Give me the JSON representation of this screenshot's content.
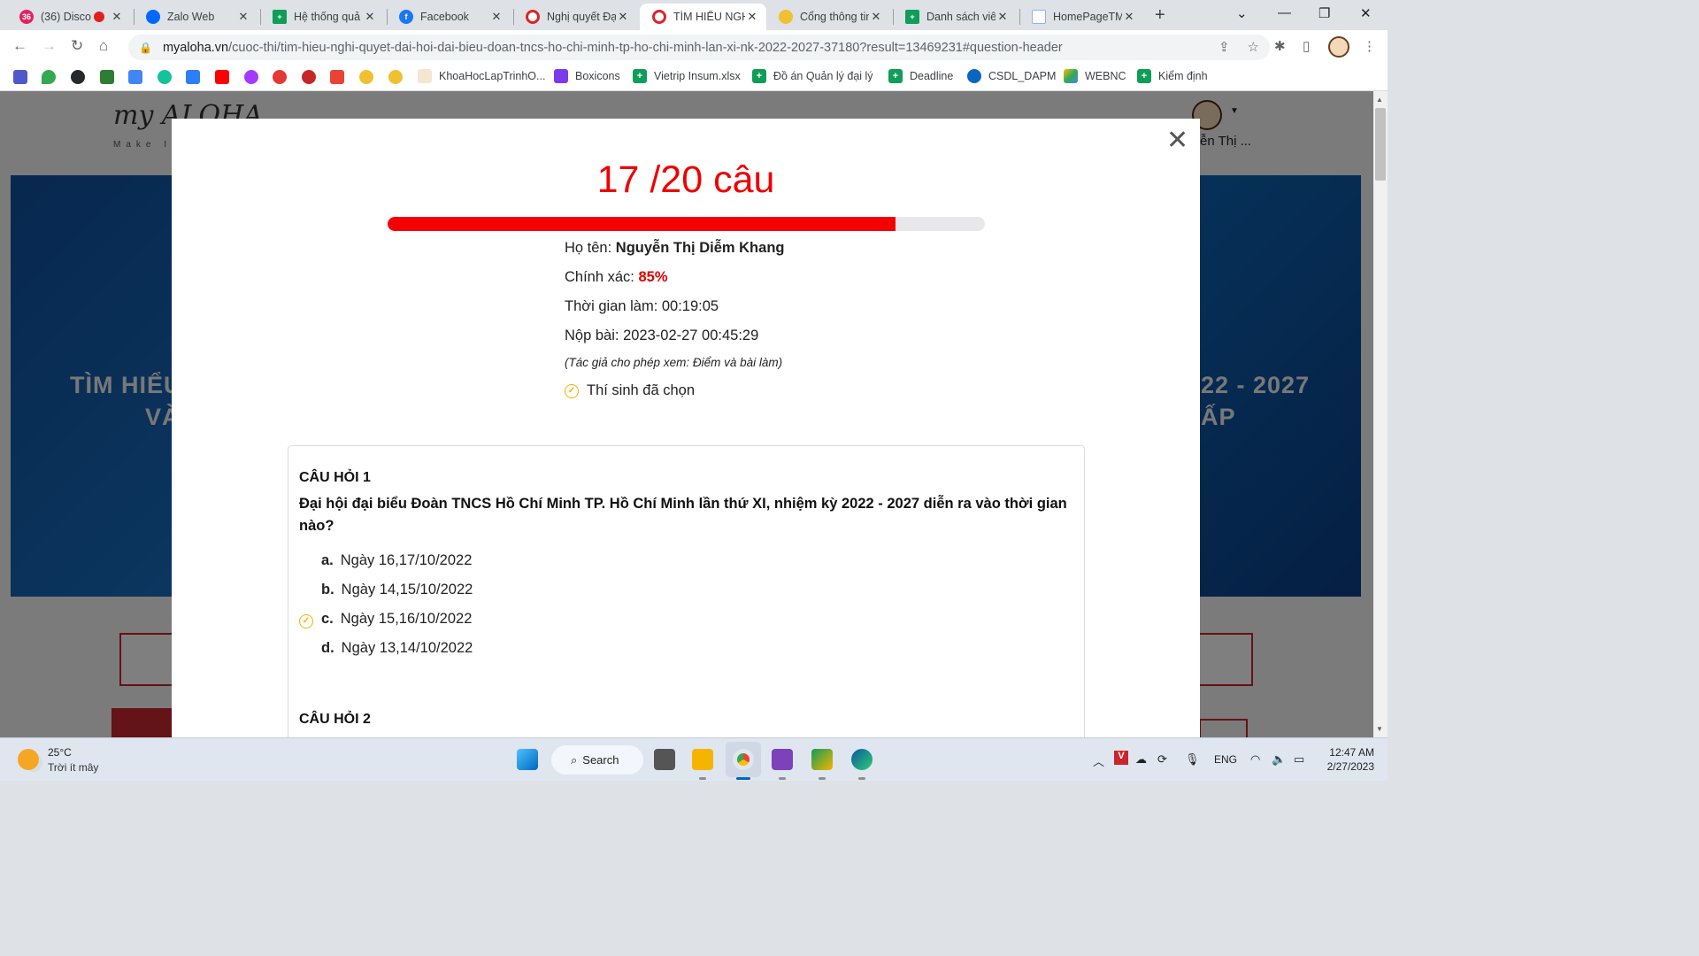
{
  "browser": {
    "tabs": [
      {
        "title": "(36) Disco",
        "badge": "36"
      },
      {
        "title": "Zalo Web"
      },
      {
        "title": "Hệ thống quả"
      },
      {
        "title": "Facebook"
      },
      {
        "title": "Nghị quyết Đạ"
      },
      {
        "title": "TÌM HIỂU NGH",
        "active": true
      },
      {
        "title": "Cổng thông tin"
      },
      {
        "title": "Danh sách viê"
      },
      {
        "title": "HomePageTM"
      }
    ],
    "url_host": "myaloha.vn",
    "url_path": "/cuoc-thi/tim-hieu-nghi-quyet-dai-hoi-dai-bieu-doan-tncs-ho-chi-minh-tp-ho-chi-minh-lan-xi-nk-2022-2027-37180?result=13469231#question-header",
    "bookmarks": [
      "KhoaHocLapTrinhO...",
      "Boxicons",
      "Vietrip Insum.xlsx",
      "Đồ án Quản lý đại lý",
      "Deadline",
      "CSDL_DAPM",
      "WEBNC",
      "Kiểm định"
    ]
  },
  "page": {
    "logo": "my ALOHA",
    "logo_tagline": "Make It",
    "user_name": "ễn Thị ...",
    "banner_left": "TÌM HIỂU",
    "banner_left2": "VÀ",
    "banner_right": "22 - 2027",
    "banner_right2": "ẤP"
  },
  "result": {
    "score_text": "17 /20 câu",
    "score_fraction": 0.85,
    "name_label": "Họ tên:",
    "name_value": "Nguyễn Thị Diễm Khang",
    "accuracy_label": "Chính xác:",
    "accuracy_value": "85%",
    "time_label": "Thời gian làm:",
    "time_value": "00:19:05",
    "submit_label": "Nộp bài:",
    "submit_value": "2023-02-27 00:45:29",
    "note": "(Tác giả cho phép xem: Điểm và bài làm)",
    "legend": "Thí sinh đã chọn"
  },
  "questions": [
    {
      "label": "CÂU HỎI 1",
      "text": "Đại hội đại biểu Đoàn TNCS Hồ Chí Minh TP. Hồ Chí Minh lần thứ XI, nhiệm kỳ 2022 - 2027 diễn ra vào thời gian nào?",
      "options": [
        {
          "letter": "a.",
          "text": "Ngày 16,17/10/2022",
          "selected": false
        },
        {
          "letter": "b.",
          "text": "Ngày 14,15/10/2022",
          "selected": false
        },
        {
          "letter": "c.",
          "text": "Ngày 15,16/10/2022",
          "selected": true
        },
        {
          "letter": "d.",
          "text": "Ngày 13,14/10/2022",
          "selected": false
        }
      ]
    },
    {
      "label": "CÂU HỎI 2"
    }
  ],
  "taskbar": {
    "temperature": "25°C",
    "weather": "Trời ít mây",
    "search": "Search",
    "lang": "ENG",
    "time": "12:47 AM",
    "date": "2/27/2023"
  },
  "colors": {
    "accent_red": "#ee0000",
    "progress_fill": "#f40000",
    "check_yellow": "#f0b400"
  }
}
